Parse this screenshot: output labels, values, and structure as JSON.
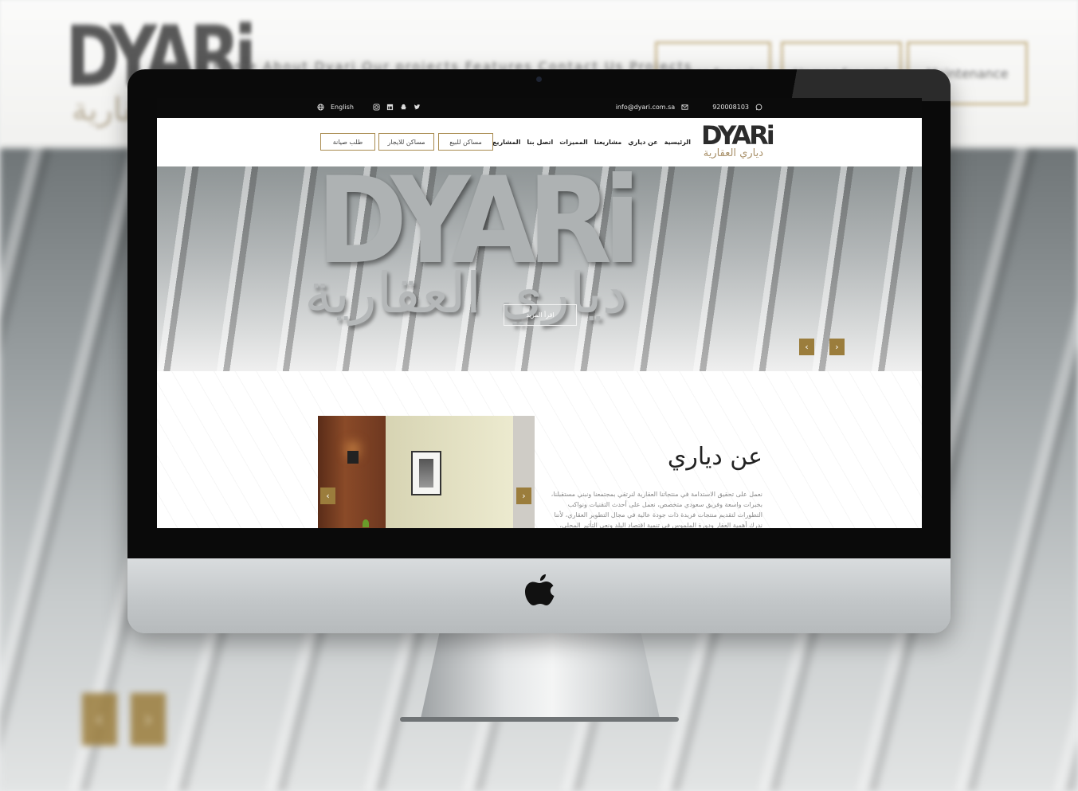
{
  "background": {
    "logo_text": "DYARi",
    "logo_ar": "ديارى العقارية",
    "nav_text": "Home About Dyari Our projects Features Contact Us Projects",
    "buttons": [
      "Homes for sale",
      "Homes for rent",
      "Maintenance"
    ]
  },
  "topbar": {
    "language": "English",
    "email": "info@dyari.com.sa",
    "phone": "920008103"
  },
  "header": {
    "logo_en": "DYARi",
    "logo_ar": "دياري العقارية",
    "nav": [
      "الرئيسية",
      "عن دياري",
      "مشاريعنا",
      "المميزات",
      "اتصل بنا",
      "المشاريع"
    ],
    "buttons": {
      "sale": "مساكن للبيع",
      "rent": "مساكن للايجار",
      "maintenance": "طلب صيانة"
    }
  },
  "hero": {
    "logo_en": "DYARi",
    "logo_ar": "دياري العقارية",
    "read_more": "اقرأ المزيد",
    "prev": "‹",
    "next": "›"
  },
  "about": {
    "title": "عن دياري",
    "text": "نعمل على تحقيق الاستدامة في منتجاتنا العقارية لنرتقي بمجتمعنا ونبني مستقبلنا، بخبرات واسعة وفريق سعودي متخصص، نعمل على أحدث التقنيات ونواكب التطورات لتقديم منتجات فريدة ذات جودة عالية في مجال التطوير العقاري، لأننا ندرك أهمية العقار ودورة الملموس في تنمية اقتصاد البلد ونعي التأثير المحلي، حرصنا على تلبية حاجة السوق العقاري محليا",
    "img_prev": "‹",
    "img_next": "›"
  },
  "colors": {
    "accent": "#9b7d3c",
    "topbar": "#0b0b0b",
    "text": "#222222"
  }
}
